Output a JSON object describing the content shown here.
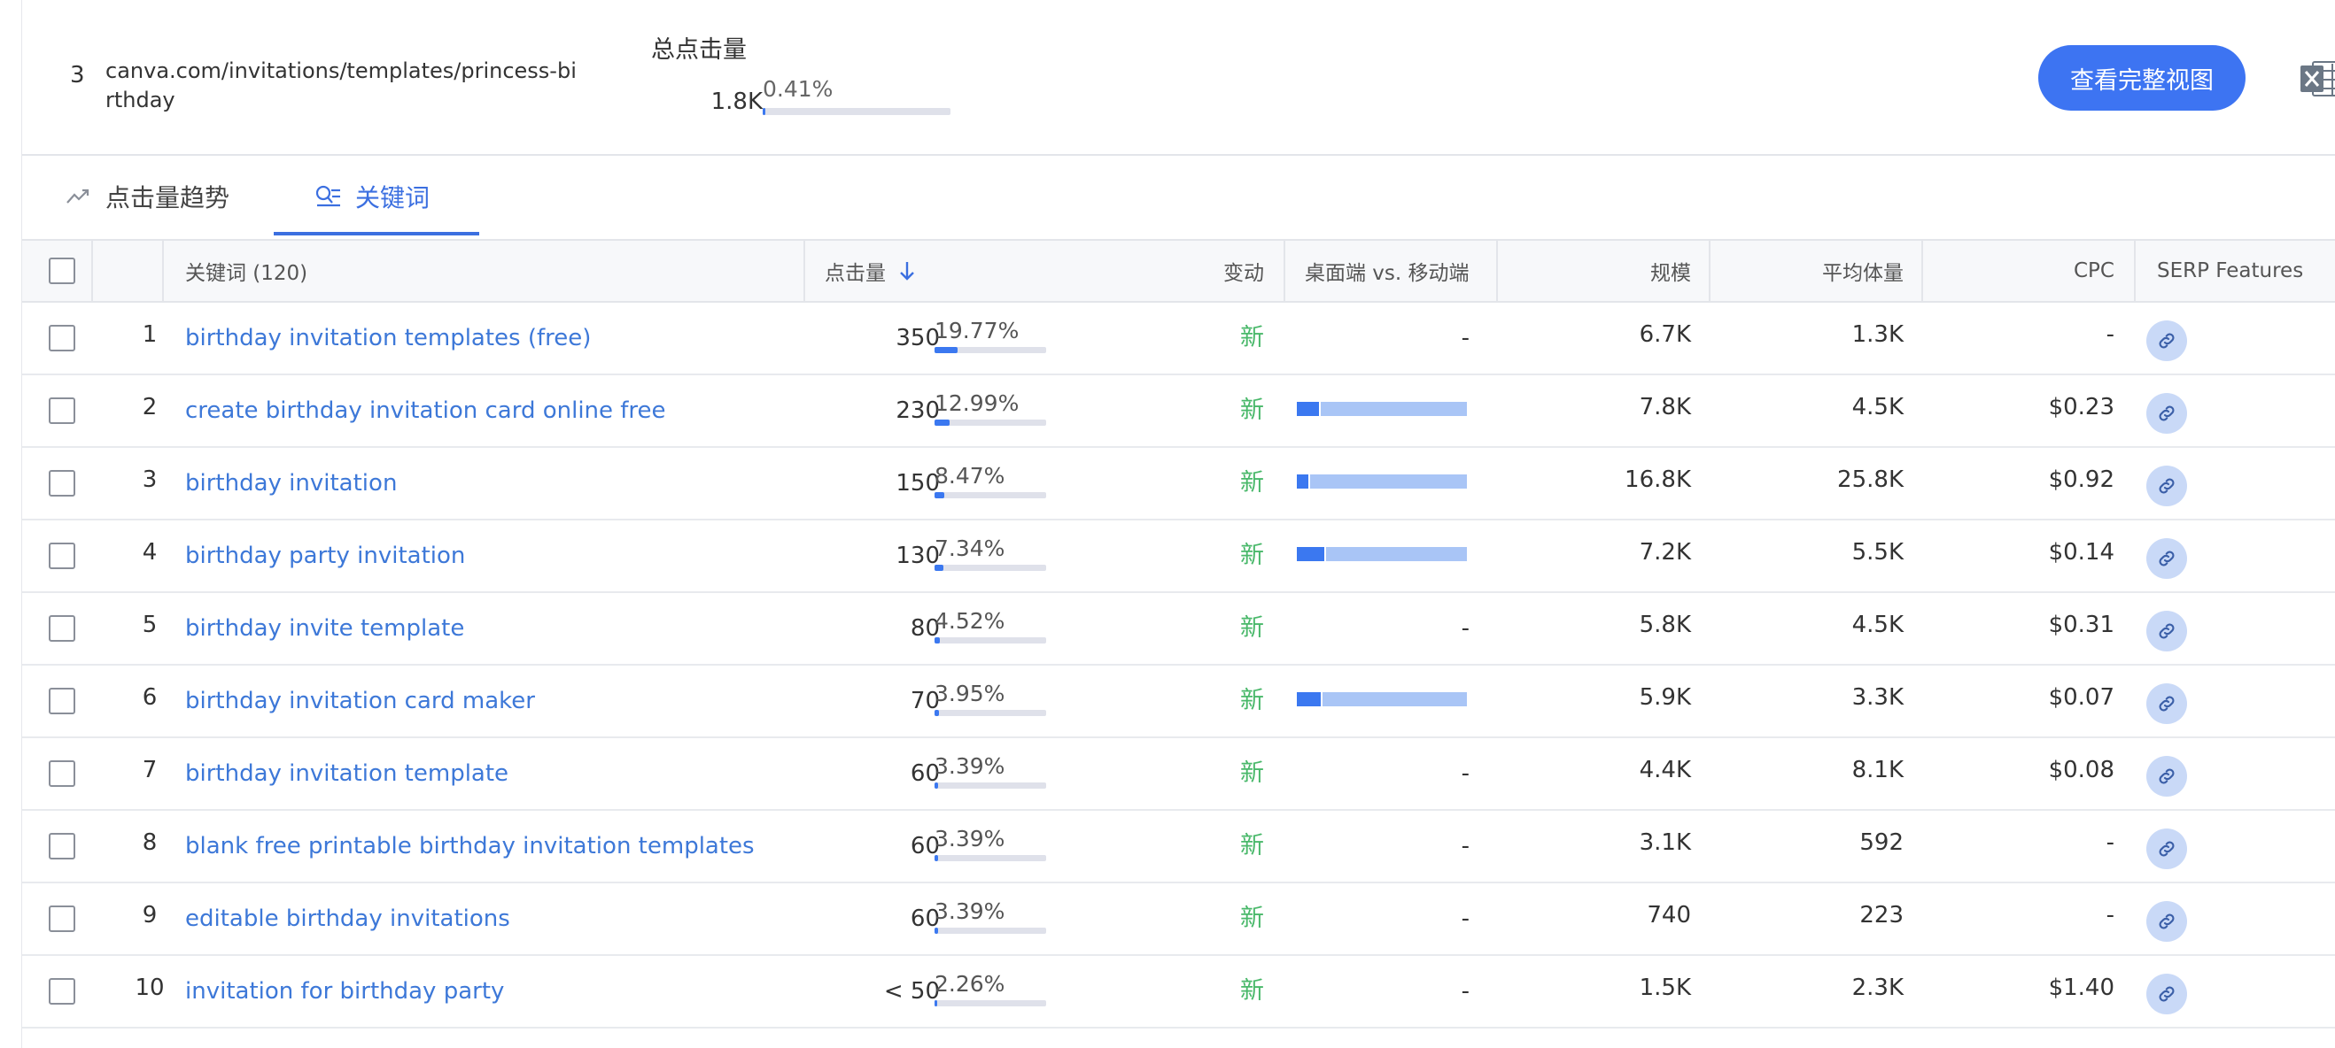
{
  "summary": {
    "rank": "3",
    "url": "canva.com/invitations/templates/princess-birthday",
    "total_clicks_label": "总点击量",
    "total_clicks_value": "1.8K",
    "total_clicks_pct": "0.41%",
    "total_clicks_fraction": 0.0041,
    "view_button_label": "查看完整视图",
    "export_icon": "excel-icon"
  },
  "tabs": [
    {
      "label": "点击量趋势",
      "icon": "trend-line-icon"
    },
    {
      "label": "关键词",
      "icon": "keyword-list-icon",
      "active": true
    }
  ],
  "table": {
    "headers": {
      "keyword": "关键词 (120)",
      "clicks": "点击量",
      "change": "变动",
      "device": "桌面端 vs. 移动端",
      "scale": "规模",
      "avg_volume": "平均体量",
      "cpc": "CPC",
      "serp": "SERP Features"
    },
    "rows": [
      {
        "idx": "1",
        "keyword": "birthday invitation templates (free)",
        "clicks": "350",
        "pct": "19.77%",
        "pct_value": 0.1977,
        "change": "新",
        "device": "-",
        "desktop_share": null,
        "scale": "6.7K",
        "avg_volume": "1.3K",
        "cpc": "-"
      },
      {
        "idx": "2",
        "keyword": "create birthday invitation card online free",
        "clicks": "230",
        "pct": "12.99%",
        "pct_value": 0.1299,
        "change": "新",
        "device": "",
        "desktop_share": 0.13,
        "scale": "7.8K",
        "avg_volume": "4.5K",
        "cpc": "$0.23"
      },
      {
        "idx": "3",
        "keyword": "birthday invitation",
        "clicks": "150",
        "pct": "8.47%",
        "pct_value": 0.0847,
        "change": "新",
        "device": "",
        "desktop_share": 0.07,
        "scale": "16.8K",
        "avg_volume": "25.8K",
        "cpc": "$0.92"
      },
      {
        "idx": "4",
        "keyword": "birthday party invitation",
        "clicks": "130",
        "pct": "7.34%",
        "pct_value": 0.0734,
        "change": "新",
        "device": "",
        "desktop_share": 0.16,
        "scale": "7.2K",
        "avg_volume": "5.5K",
        "cpc": "$0.14"
      },
      {
        "idx": "5",
        "keyword": "birthday invite template",
        "clicks": "80",
        "pct": "4.52%",
        "pct_value": 0.0452,
        "change": "新",
        "device": "-",
        "desktop_share": null,
        "scale": "5.8K",
        "avg_volume": "4.5K",
        "cpc": "$0.31"
      },
      {
        "idx": "6",
        "keyword": "birthday invitation card maker",
        "clicks": "70",
        "pct": "3.95%",
        "pct_value": 0.0395,
        "change": "新",
        "device": "",
        "desktop_share": 0.14,
        "scale": "5.9K",
        "avg_volume": "3.3K",
        "cpc": "$0.07"
      },
      {
        "idx": "7",
        "keyword": "birthday invitation template",
        "clicks": "60",
        "pct": "3.39%",
        "pct_value": 0.0339,
        "change": "新",
        "device": "-",
        "desktop_share": null,
        "scale": "4.4K",
        "avg_volume": "8.1K",
        "cpc": "$0.08"
      },
      {
        "idx": "8",
        "keyword": "blank free printable birthday invitation templates",
        "clicks": "60",
        "pct": "3.39%",
        "pct_value": 0.0339,
        "change": "新",
        "device": "-",
        "desktop_share": null,
        "scale": "3.1K",
        "avg_volume": "592",
        "cpc": "-"
      },
      {
        "idx": "9",
        "keyword": "editable birthday invitations",
        "clicks": "60",
        "pct": "3.39%",
        "pct_value": 0.0339,
        "change": "新",
        "device": "-",
        "desktop_share": null,
        "scale": "740",
        "avg_volume": "223",
        "cpc": "-"
      },
      {
        "idx": "10",
        "keyword": "invitation for birthday party",
        "clicks": "< 50",
        "pct": "2.26%",
        "pct_value": 0.0226,
        "change": "新",
        "device": "-",
        "desktop_share": null,
        "scale": "1.5K",
        "avg_volume": "2.3K",
        "cpc": "$1.40"
      }
    ]
  },
  "colors": {
    "accent": "#3b6fe0",
    "button": "#3d74f2",
    "link": "#3d78d8",
    "new_green": "#49b86a",
    "bar_fill": "#3b78f0",
    "bar_track": "#dfe1ea",
    "mobile_share": "#a9c5f6"
  }
}
